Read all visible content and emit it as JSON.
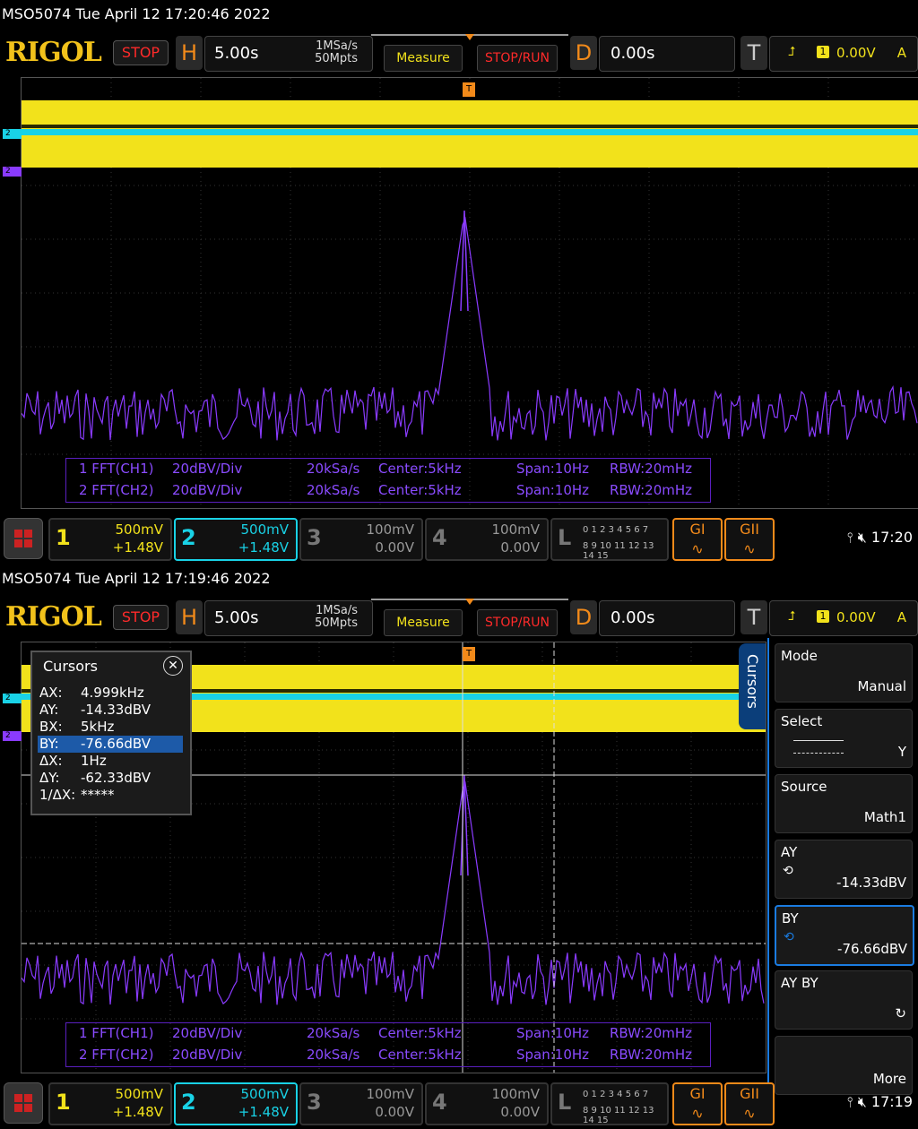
{
  "screens": [
    {
      "title_line": "MSO5074  Tue April 12 17:20:46 2022",
      "header": {
        "logo": "RIGOL",
        "stop": "STOP",
        "h_letter": "H",
        "timebase": "5.00s",
        "sample_rate": "1MSa/s",
        "mem_depth": "50Mpts",
        "measure": "Measure",
        "stop_run": "STOP/RUN",
        "d_letter": "D",
        "delay": "0.00s",
        "t_letter": "T",
        "trig_source": "1",
        "trig_level": "0.00V",
        "trig_mode": "A"
      },
      "fft_info": [
        {
          "line": "1 FFT(CH1)",
          "scale": "20dBV/Div",
          "rate": "20kSa/s",
          "center": "Center:5kHz",
          "span": "Span:10Hz",
          "rbw": "RBW:20mHz"
        },
        {
          "line": "2 FFT(CH2)",
          "scale": "20dBV/Div",
          "rate": "20kSa/s",
          "center": "Center:5kHz",
          "span": "Span:10Hz",
          "rbw": "RBW:20mHz"
        }
      ],
      "channels": [
        {
          "num": "1",
          "scale": "500mV",
          "offset": "+1.48V",
          "color": "#f2e21b"
        },
        {
          "num": "2",
          "scale": "500mV",
          "offset": "+1.48V",
          "color": "#19d2e6"
        },
        {
          "num": "3",
          "scale": "100mV",
          "offset": "0.00V",
          "color": "#777777"
        },
        {
          "num": "4",
          "scale": "100mV",
          "offset": "0.00V",
          "color": "#777777"
        }
      ],
      "la_label": "L",
      "la_row1": "0 1 2 3  4 5 6 7",
      "la_row2": "8 9 10 11 12 13 14 15",
      "g1": "GI",
      "g2": "GII",
      "clock": "17:20"
    },
    {
      "title_line": "MSO5074  Tue April 12 17:19:46 2022",
      "header": {
        "logo": "RIGOL",
        "stop": "STOP",
        "h_letter": "H",
        "timebase": "5.00s",
        "sample_rate": "1MSa/s",
        "mem_depth": "50Mpts",
        "measure": "Measure",
        "stop_run": "STOP/RUN",
        "d_letter": "D",
        "delay": "0.00s",
        "t_letter": "T",
        "trig_source": "1",
        "trig_level": "0.00V",
        "trig_mode": "A"
      },
      "fft_info": [
        {
          "line": "1 FFT(CH1)",
          "scale": "20dBV/Div",
          "rate": "20kSa/s",
          "center": "Center:5kHz",
          "span": "Span:10Hz",
          "rbw": "RBW:20mHz"
        },
        {
          "line": "2 FFT(CH2)",
          "scale": "20dBV/Div",
          "rate": "20kSa/s",
          "center": "Center:5kHz",
          "span": "Span:10Hz",
          "rbw": "RBW:20mHz"
        }
      ],
      "channels": [
        {
          "num": "1",
          "scale": "500mV",
          "offset": "+1.48V",
          "color": "#f2e21b"
        },
        {
          "num": "2",
          "scale": "500mV",
          "offset": "+1.48V",
          "color": "#19d2e6"
        },
        {
          "num": "3",
          "scale": "100mV",
          "offset": "0.00V",
          "color": "#777777"
        },
        {
          "num": "4",
          "scale": "100mV",
          "offset": "0.00V",
          "color": "#777777"
        }
      ],
      "la_label": "L",
      "la_row1": "0 1 2 3  4 5 6 7",
      "la_row2": "8 9 10 11 12 13 14 15",
      "g1": "GI",
      "g2": "GII",
      "clock": "17:19",
      "cursors": {
        "title": "Cursors",
        "rows": [
          {
            "k": "AX:",
            "v": "4.999kHz"
          },
          {
            "k": "AY:",
            "v": "-14.33dBV"
          },
          {
            "k": "BX:",
            "v": "5kHz"
          },
          {
            "k": "BY:",
            "v": "-76.66dBV"
          },
          {
            "k": "ΔX:",
            "v": "1Hz"
          },
          {
            "k": "ΔY:",
            "v": "-62.33dBV"
          },
          {
            "k": "1/ΔX:",
            "v": "*****"
          }
        ],
        "selected_row": 3
      },
      "side_menu": {
        "tab": "Cursors",
        "items": [
          {
            "label": "Mode",
            "value": "Manual"
          },
          {
            "label": "Select",
            "value": "Y"
          },
          {
            "label": "Source",
            "value": "Math1"
          },
          {
            "label": "AY",
            "value": "-14.33dBV"
          },
          {
            "label": "BY",
            "value": "-76.66dBV"
          },
          {
            "label": "AY BY",
            "value": "↻"
          },
          {
            "label": "",
            "value": "More"
          }
        ]
      }
    }
  ],
  "icons": [
    "usb-icon",
    "mute-icon",
    "close-icon",
    "knob-icon",
    "trigger-edge-icon",
    "menu-icon"
  ],
  "colors": {
    "ch1": "#f2e21b",
    "ch2": "#19d2e6",
    "math": "#8a3bff",
    "orange": "#f28a1a",
    "select": "#1a7be0"
  }
}
